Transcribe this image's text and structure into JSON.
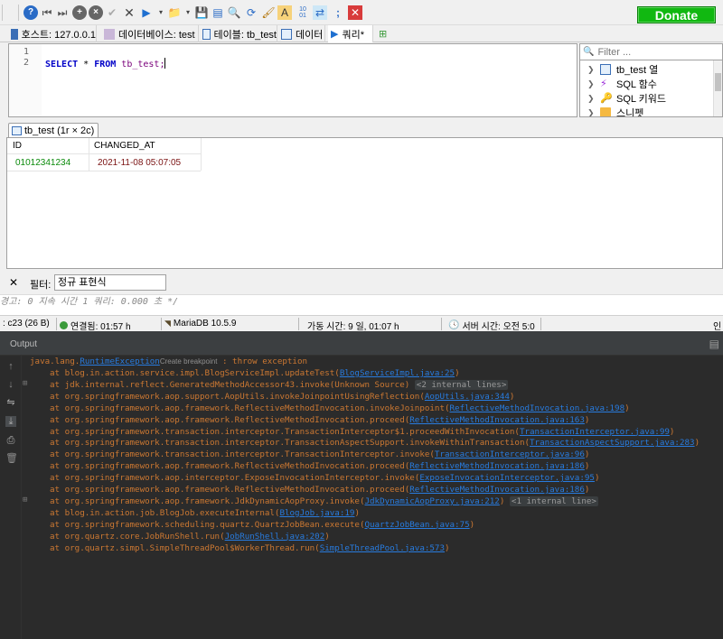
{
  "toolbar": {
    "donate_label": "Donate"
  },
  "tabs": [
    {
      "label": "호스트: 127.0.0.1"
    },
    {
      "label": "데이터베이스: test"
    },
    {
      "label": "테이블: tb_test"
    },
    {
      "label": "데이터"
    },
    {
      "label": "쿼리*"
    }
  ],
  "editor": {
    "line1": "1",
    "line2": "2",
    "sql_kw1": "SELECT",
    "sql_star": " * ",
    "sql_kw2": "FROM",
    "sql_table": " tb_test;"
  },
  "tree": {
    "filter_placeholder": "Filter ...",
    "items": [
      {
        "label": "tb_test 열"
      },
      {
        "label": "SQL 함수"
      },
      {
        "label": "SQL 키워드"
      },
      {
        "label": "스니펫"
      }
    ]
  },
  "result": {
    "tab_label": "tb_test (1r × 2c)",
    "columns": [
      "ID",
      "CHANGED_AT"
    ],
    "rows": [
      [
        "01012341234",
        "2021-11-08 05:07:05"
      ]
    ]
  },
  "filter": {
    "label": "필터:",
    "value": "정규 표현식"
  },
  "message": "경고: 0  지속 시간 1 쿼리: 0.000 초 */",
  "status": {
    "pos": ": c23 (26 B)",
    "connected": "연결됨: 01:57 h",
    "server": "MariaDB 10.5.9",
    "uptime": "가동 시간: 9 일, 01:07 h",
    "server_time": "서버 시간: 오전 5:0",
    "last": "인"
  },
  "output": {
    "title": "Output",
    "exception_prefix": "java.lang.",
    "exception_name": "RuntimeException",
    "breakpoint_hint": "Create breakpoint",
    "exception_suffix": " : throw exception",
    "lines": [
      {
        "text": "at blog.in.action.service.impl.BlogServiceImpl.updateTest(",
        "link": "BlogServiceImpl.java:25",
        "end": ")",
        "hint": ""
      },
      {
        "text": "at jdk.internal.reflect.GeneratedMethodAccessor43.invoke(Unknown Source) ",
        "link": "",
        "end": "",
        "hint": "<2 internal lines>"
      },
      {
        "text": "at org.springframework.aop.support.AopUtils.invokeJoinpointUsingReflection(",
        "link": "AopUtils.java:344",
        "end": ")",
        "hint": ""
      },
      {
        "text": "at org.springframework.aop.framework.ReflectiveMethodInvocation.invokeJoinpoint(",
        "link": "ReflectiveMethodInvocation.java:198",
        "end": ")",
        "hint": ""
      },
      {
        "text": "at org.springframework.aop.framework.ReflectiveMethodInvocation.proceed(",
        "link": "ReflectiveMethodInvocation.java:163",
        "end": ")",
        "hint": ""
      },
      {
        "text": "at org.springframework.transaction.interceptor.TransactionInterceptor$1.proceedWithInvocation(",
        "link": "TransactionInterceptor.java:99",
        "end": ")",
        "hint": ""
      },
      {
        "text": "at org.springframework.transaction.interceptor.TransactionAspectSupport.invokeWithinTransaction(",
        "link": "TransactionAspectSupport.java:283",
        "end": ")",
        "hint": ""
      },
      {
        "text": "at org.springframework.transaction.interceptor.TransactionInterceptor.invoke(",
        "link": "TransactionInterceptor.java:96",
        "end": ")",
        "hint": ""
      },
      {
        "text": "at org.springframework.aop.framework.ReflectiveMethodInvocation.proceed(",
        "link": "ReflectiveMethodInvocation.java:186",
        "end": ")",
        "hint": ""
      },
      {
        "text": "at org.springframework.aop.interceptor.ExposeInvocationInterceptor.invoke(",
        "link": "ExposeInvocationInterceptor.java:95",
        "end": ")",
        "hint": ""
      },
      {
        "text": "at org.springframework.aop.framework.ReflectiveMethodInvocation.proceed(",
        "link": "ReflectiveMethodInvocation.java:186",
        "end": ")",
        "hint": ""
      },
      {
        "text": "at org.springframework.aop.framework.JdkDynamicAopProxy.invoke(",
        "link": "JdkDynamicAopProxy.java:212",
        "end": ") ",
        "hint": "<1 internal line>"
      },
      {
        "text": "at blog.in.action.job.BlogJob.executeInternal(",
        "link": "BlogJob.java:19",
        "end": ")",
        "hint": ""
      },
      {
        "text": "at org.springframework.scheduling.quartz.QuartzJobBean.execute(",
        "link": "QuartzJobBean.java:75",
        "end": ")",
        "hint": ""
      },
      {
        "text": "at org.quartz.core.JobRunShell.run(",
        "link": "JobRunShell.java:202",
        "end": ")",
        "hint": ""
      },
      {
        "text": "at org.quartz.simpl.SimpleThreadPool$WorkerThread.run(",
        "link": "SimpleThreadPool.java:573",
        "end": ")",
        "hint": ""
      }
    ]
  }
}
